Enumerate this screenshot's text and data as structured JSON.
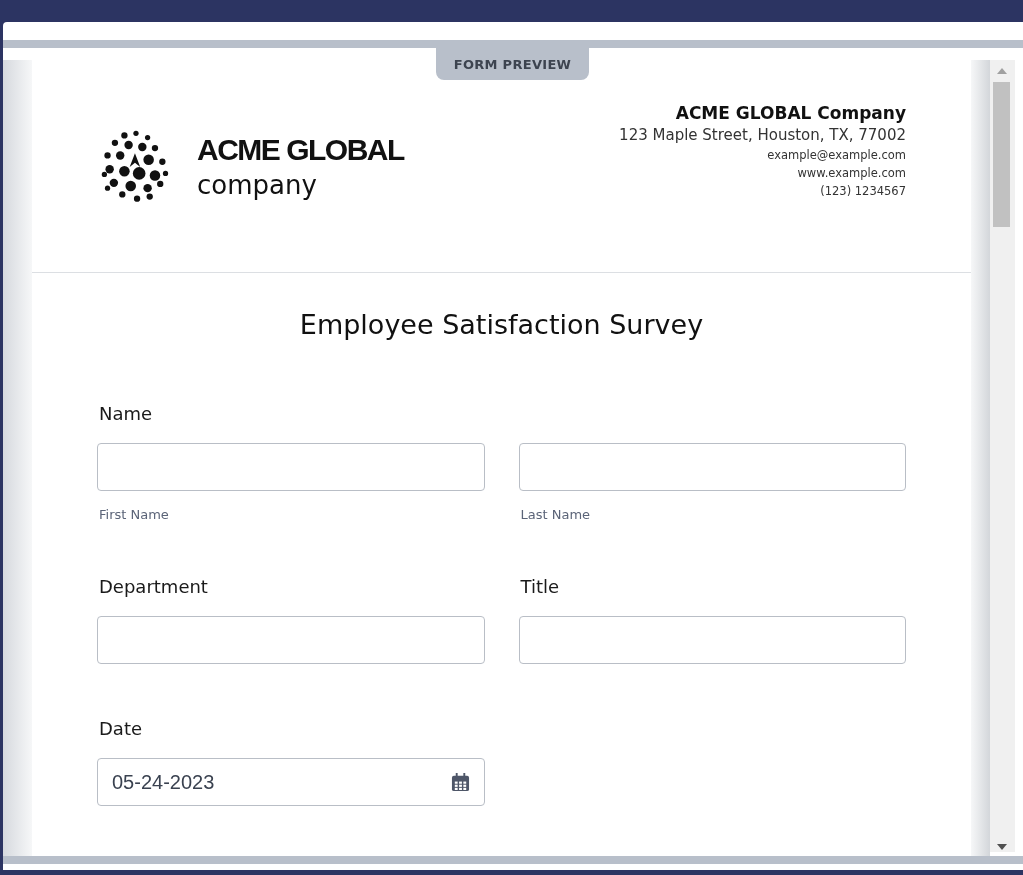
{
  "modal": {
    "tab_label": "FORM PREVIEW"
  },
  "header": {
    "logo": {
      "line1": "ACME GLOBAL",
      "line2": "company"
    },
    "company": {
      "name": "ACME GLOBAL Company",
      "address": "123 Maple Street, Houston, TX, 77002",
      "email": "example@example.com",
      "website": "www.example.com",
      "phone": "(123) 1234567"
    }
  },
  "form": {
    "title": "Employee Satisfaction Survey",
    "rows": [
      {
        "label": "Name",
        "fields": [
          {
            "kind": "text",
            "sublabel": "First Name"
          },
          {
            "kind": "text",
            "sublabel": "Last Name"
          }
        ]
      },
      {
        "fields": [
          {
            "kind": "text",
            "label": "Department"
          },
          {
            "kind": "text",
            "label": "Title"
          }
        ]
      },
      {
        "fields": [
          {
            "kind": "date",
            "label": "Date",
            "value": "05-24-2023"
          }
        ]
      }
    ]
  }
}
